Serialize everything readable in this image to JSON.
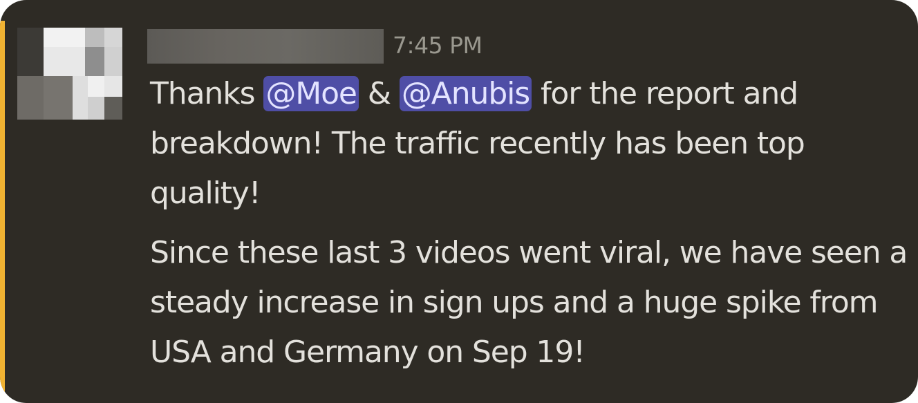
{
  "message": {
    "timestamp": "7:45 PM",
    "paragraph1": {
      "prefix": "Thanks ",
      "mention1": "@Moe",
      "connector": " & ",
      "mention2": "@Anubis",
      "suffix": " for the report and breakdown! The traffic recently has been top quality!"
    },
    "paragraph2": "Since these last 3 videos went viral, we have seen a steady increase in sign ups and a huge spike from USA and Germany on Sep 19!"
  },
  "colors": {
    "background": "#2e2b25",
    "highlight_bar": "#f0b232",
    "mention_bg": "#4f4ea6",
    "text": "#e3e1dc",
    "timestamp": "#9a988f"
  }
}
